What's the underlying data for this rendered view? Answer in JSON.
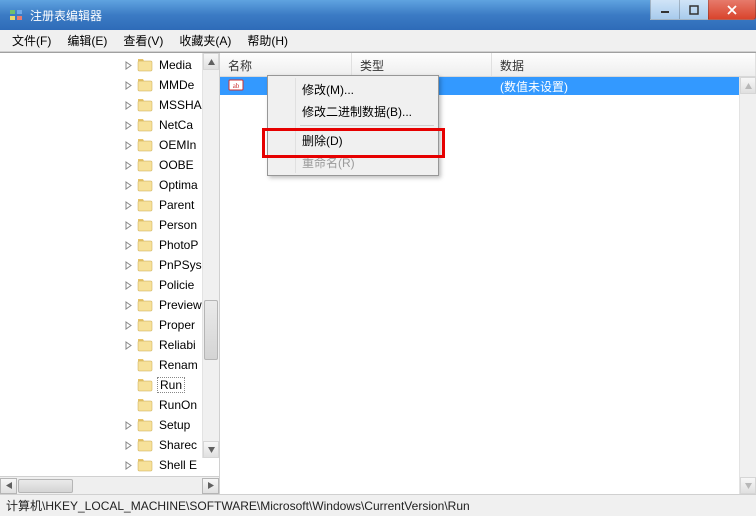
{
  "window": {
    "title": "注册表编辑器"
  },
  "menu": {
    "file": "文件(F)",
    "edit": "编辑(E)",
    "view": "查看(V)",
    "favorites": "收藏夹(A)",
    "help": "帮助(H)"
  },
  "tree": {
    "items": [
      {
        "label": "Media",
        "expanded": false,
        "hasChildren": true
      },
      {
        "label": "MMDe",
        "expanded": false,
        "hasChildren": true
      },
      {
        "label": "MSSHA",
        "expanded": false,
        "hasChildren": true
      },
      {
        "label": "NetCa",
        "expanded": false,
        "hasChildren": true
      },
      {
        "label": "OEMIn",
        "expanded": false,
        "hasChildren": true
      },
      {
        "label": "OOBE",
        "expanded": false,
        "hasChildren": true
      },
      {
        "label": "Optima",
        "expanded": false,
        "hasChildren": true
      },
      {
        "label": "Parent",
        "expanded": false,
        "hasChildren": true
      },
      {
        "label": "Person",
        "expanded": false,
        "hasChildren": true
      },
      {
        "label": "PhotoP",
        "expanded": false,
        "hasChildren": true
      },
      {
        "label": "PnPSys",
        "expanded": false,
        "hasChildren": true
      },
      {
        "label": "Policie",
        "expanded": false,
        "hasChildren": true
      },
      {
        "label": "Preview",
        "expanded": false,
        "hasChildren": true
      },
      {
        "label": "Proper",
        "expanded": false,
        "hasChildren": true
      },
      {
        "label": "Reliabi",
        "expanded": false,
        "hasChildren": true
      },
      {
        "label": "Renam",
        "expanded": false,
        "hasChildren": false
      },
      {
        "label": "Run",
        "expanded": false,
        "hasChildren": false,
        "selected": true
      },
      {
        "label": "RunOn",
        "expanded": false,
        "hasChildren": false
      },
      {
        "label": "Setup",
        "expanded": false,
        "hasChildren": true
      },
      {
        "label": "Sharec",
        "expanded": false,
        "hasChildren": true
      },
      {
        "label": "Shell E",
        "expanded": false,
        "hasChildren": true
      }
    ]
  },
  "list": {
    "columns": {
      "name": "名称",
      "type": "类型",
      "data": "数据"
    },
    "col_widths": {
      "name": 132,
      "type": 140,
      "data": 250
    },
    "rows": [
      {
        "icon": "string-value",
        "name": "",
        "type": "",
        "data": "(数值未设置)",
        "selected": true
      }
    ]
  },
  "context_menu": {
    "modify": "修改(M)...",
    "modify_binary": "修改二进制数据(B)...",
    "delete": "删除(D)",
    "rename": "重命名(R)"
  },
  "statusbar": {
    "path": "计算机\\HKEY_LOCAL_MACHINE\\SOFTWARE\\Microsoft\\Windows\\CurrentVersion\\Run"
  }
}
